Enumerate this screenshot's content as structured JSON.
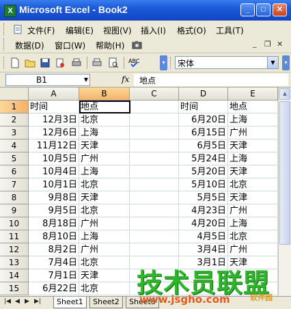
{
  "window": {
    "title": "Microsoft Excel - Book2",
    "app_icon": "X",
    "min": "_",
    "max": "□",
    "close": "✕"
  },
  "menubar": {
    "items": [
      "文件(F)",
      "编辑(E)",
      "视图(V)",
      "插入(I)",
      "格式(O)",
      "工具(T)",
      "数据(D)",
      "窗口(W)",
      "帮助(H)"
    ],
    "mdi_min": "_",
    "mdi_restore": "❐",
    "mdi_close": "✕"
  },
  "toolbar": {
    "font_name": "宋体"
  },
  "formula_bar": {
    "name_box": "B1",
    "fx": "fx",
    "content": "地点"
  },
  "grid": {
    "columns": [
      "A",
      "B",
      "C",
      "D",
      "E"
    ],
    "rows": [
      "1",
      "2",
      "3",
      "4",
      "5",
      "6",
      "7",
      "8",
      "9",
      "10",
      "11",
      "12",
      "13",
      "14",
      "15"
    ],
    "cells": [
      [
        "时间",
        "地点",
        "",
        "时间",
        "地点"
      ],
      [
        "12月3日",
        "北京",
        "",
        "6月20日",
        "上海"
      ],
      [
        "12月6日",
        "上海",
        "",
        "6月15日",
        "广州"
      ],
      [
        "11月12日",
        "天津",
        "",
        "6月5日",
        "天津"
      ],
      [
        "10月5日",
        "广州",
        "",
        "5月24日",
        "上海"
      ],
      [
        "10月4日",
        "上海",
        "",
        "5月20日",
        "天津"
      ],
      [
        "10月1日",
        "北京",
        "",
        "5月10日",
        "北京"
      ],
      [
        "9月8日",
        "天津",
        "",
        "5月5日",
        "天津"
      ],
      [
        "9月5日",
        "北京",
        "",
        "4月23日",
        "广州"
      ],
      [
        "8月18日",
        "广州",
        "",
        "4月20日",
        "上海"
      ],
      [
        "8月10日",
        "上海",
        "",
        "4月5日",
        "北京"
      ],
      [
        "8月2日",
        "广州",
        "",
        "3月4日",
        "广州"
      ],
      [
        "7月4日",
        "北京",
        "",
        "3月1日",
        "天津"
      ],
      [
        "7月1日",
        "天津",
        "",
        "",
        ""
      ],
      [
        "6月22日",
        "北京",
        "",
        "",
        ""
      ]
    ]
  },
  "sheets": [
    "Sheet1",
    "Sheet2",
    "Sheet3"
  ],
  "watermark": {
    "text": "技术员联盟",
    "url": "www.jsgho.com",
    "sub": "软件园"
  }
}
